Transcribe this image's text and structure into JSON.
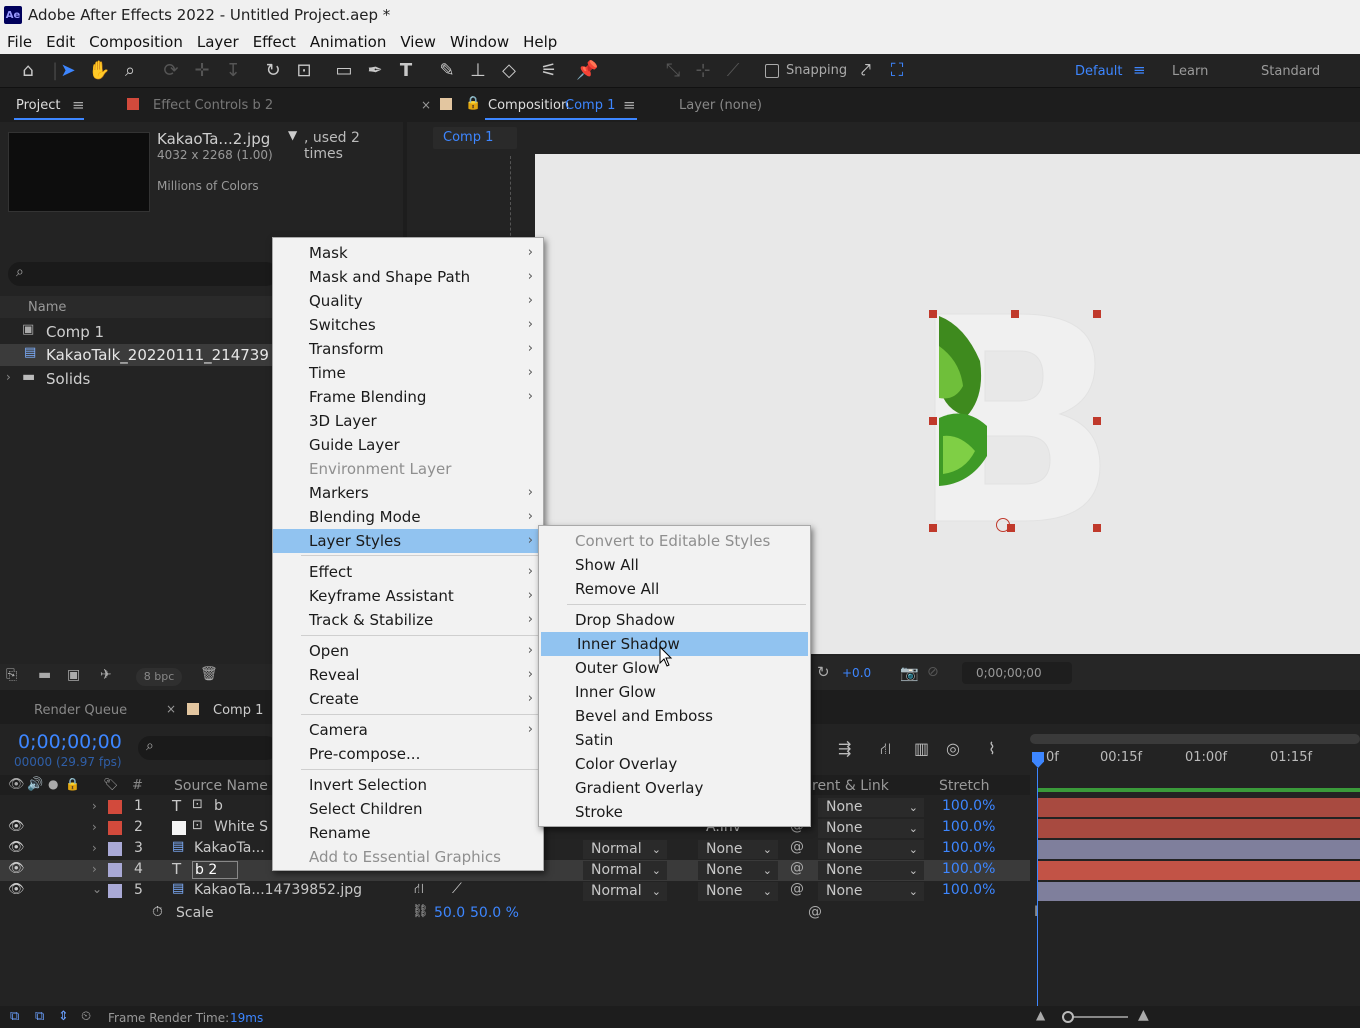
{
  "app": {
    "title": "Adobe After Effects 2022 - Untitled Project.aep *",
    "logo": "Ae"
  },
  "menubar": [
    "File",
    "Edit",
    "Composition",
    "Layer",
    "Effect",
    "Animation",
    "View",
    "Window",
    "Help"
  ],
  "toolbar": {
    "snapping_label": "Snapping",
    "workspaces": {
      "default": "Default",
      "learn": "Learn",
      "standard": "Standard"
    }
  },
  "project_panel": {
    "tab_project": "Project",
    "tab_effect_controls": "Effect Controls b 2",
    "file_name": "KakaoTa...2.jpg",
    "used": ", used 2 times",
    "dimensions": "4032 x 2268 (1.00)",
    "colors": "Millions of Colors",
    "col_name": "Name",
    "items": [
      {
        "label": "Comp 1",
        "icon": "composition-icon"
      },
      {
        "label": "KakaoTalk_20220111_214739",
        "icon": "image-file-icon"
      },
      {
        "label": "Solids",
        "icon": "folder-icon"
      }
    ],
    "bpc": "8 bpc"
  },
  "comp_panel": {
    "tab_label": "Composition",
    "comp_name": "Comp 1",
    "layer_tab": "Layer (none)",
    "sub_tab": "Comp 1",
    "exposure": "+0.0",
    "timecode": "0;00;00;00"
  },
  "context_menu": {
    "items": [
      {
        "label": "Mask",
        "sub": true
      },
      {
        "label": "Mask and Shape Path",
        "sub": true
      },
      {
        "label": "Quality",
        "sub": true
      },
      {
        "label": "Switches",
        "sub": true
      },
      {
        "label": "Transform",
        "sub": true
      },
      {
        "label": "Time",
        "sub": true
      },
      {
        "label": "Frame Blending",
        "sub": true
      },
      {
        "label": "3D Layer",
        "sub": false
      },
      {
        "label": "Guide Layer",
        "sub": false
      },
      {
        "label": "Environment Layer",
        "sub": false,
        "disabled": true
      },
      {
        "label": "Markers",
        "sub": true
      },
      {
        "label": "Blending Mode",
        "sub": true
      },
      {
        "label": "Layer Styles",
        "sub": true,
        "highlighted": true
      },
      {
        "label": "Effect",
        "sub": true
      },
      {
        "label": "Keyframe Assistant",
        "sub": true
      },
      {
        "label": "Track & Stabilize",
        "sub": true
      },
      {
        "label": "Open",
        "sub": true
      },
      {
        "label": "Reveal",
        "sub": true
      },
      {
        "label": "Create",
        "sub": true
      },
      {
        "label": "Camera",
        "sub": true
      },
      {
        "label": "Pre-compose...",
        "sub": false
      },
      {
        "label": "Invert Selection",
        "sub": false
      },
      {
        "label": "Select Children",
        "sub": false
      },
      {
        "label": "Rename",
        "sub": false
      },
      {
        "label": "Add to Essential Graphics",
        "sub": false,
        "disabled": true
      }
    ]
  },
  "submenu": {
    "items": [
      {
        "label": "Convert to Editable Styles",
        "disabled": true
      },
      {
        "label": "Show All"
      },
      {
        "label": "Remove All"
      },
      {
        "label": "Drop Shadow"
      },
      {
        "label": "Inner Shadow",
        "highlighted": true
      },
      {
        "label": "Outer Glow"
      },
      {
        "label": "Inner Glow"
      },
      {
        "label": "Bevel and Emboss"
      },
      {
        "label": "Satin"
      },
      {
        "label": "Color Overlay"
      },
      {
        "label": "Gradient Overlay"
      },
      {
        "label": "Stroke"
      }
    ]
  },
  "timeline": {
    "tab_render_queue": "Render Queue",
    "tab_comp": "Comp 1",
    "timecode": "0;00;00;00",
    "frames": "00000 (29.97 fps)",
    "col_hash": "#",
    "col_source": "Source Name",
    "col_parent": "rent & Link",
    "col_stretch": "Stretch",
    "ruler": [
      "0f",
      "00:15f",
      "01:00f",
      "01:15f"
    ],
    "layers": [
      {
        "num": "1",
        "name": "b",
        "type": "T",
        "color": "#d24a3c",
        "mode": "",
        "trk": "",
        "parent": "None",
        "stretch": "100.0%"
      },
      {
        "num": "2",
        "name": "White S",
        "type": "solid",
        "color": "#d24a3c",
        "mode": "Normal",
        "trk": "A.Inv",
        "parent": "None",
        "stretch": "100.0%"
      },
      {
        "num": "3",
        "name": "KakaoTa...",
        "type": "img",
        "color": "#a9a9d6",
        "mode": "Normal",
        "trk": "None",
        "parent": "None",
        "stretch": "100.0%"
      },
      {
        "num": "4",
        "name": "b 2",
        "type": "T",
        "color": "#d24a3c",
        "mode": "Normal",
        "trk": "None",
        "parent": "None",
        "stretch": "100.0%"
      },
      {
        "num": "5",
        "name": "KakaoTa...14739852.jpg",
        "type": "img",
        "color": "#a9a9d6",
        "mode": "Normal",
        "trk": "None",
        "parent": "None",
        "stretch": "100.0%"
      }
    ],
    "scale_label": "Scale",
    "scale_value_a": "50.0",
    "scale_value_b": "50.0 %",
    "render_time_label": "Frame Render Time:",
    "render_time_value": "19ms"
  },
  "colors": {
    "accent": "#3d86ff",
    "label_red": "#d24a3c",
    "label_lavender": "#a9a9d6",
    "menu_highlight": "#91c3f0"
  }
}
